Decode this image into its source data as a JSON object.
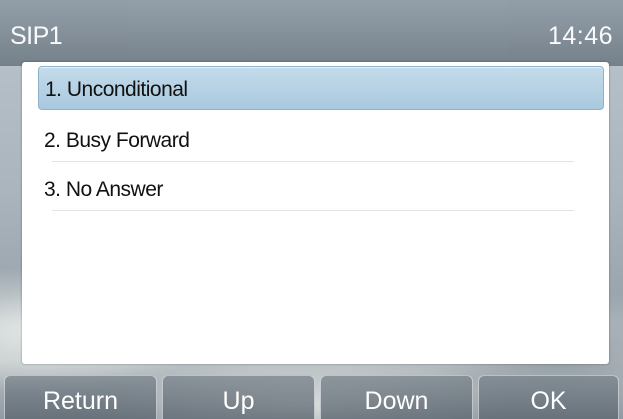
{
  "status_bar": {
    "title": "SIP1",
    "time": "14:46"
  },
  "menu": {
    "items": [
      {
        "label": "1. Unconditional",
        "selected": true
      },
      {
        "label": "2. Busy Forward",
        "selected": false
      },
      {
        "label": "3. No Answer",
        "selected": false
      }
    ]
  },
  "softkeys": {
    "return_label": "Return",
    "up_label": "Up",
    "down_label": "Down",
    "ok_label": "OK"
  }
}
